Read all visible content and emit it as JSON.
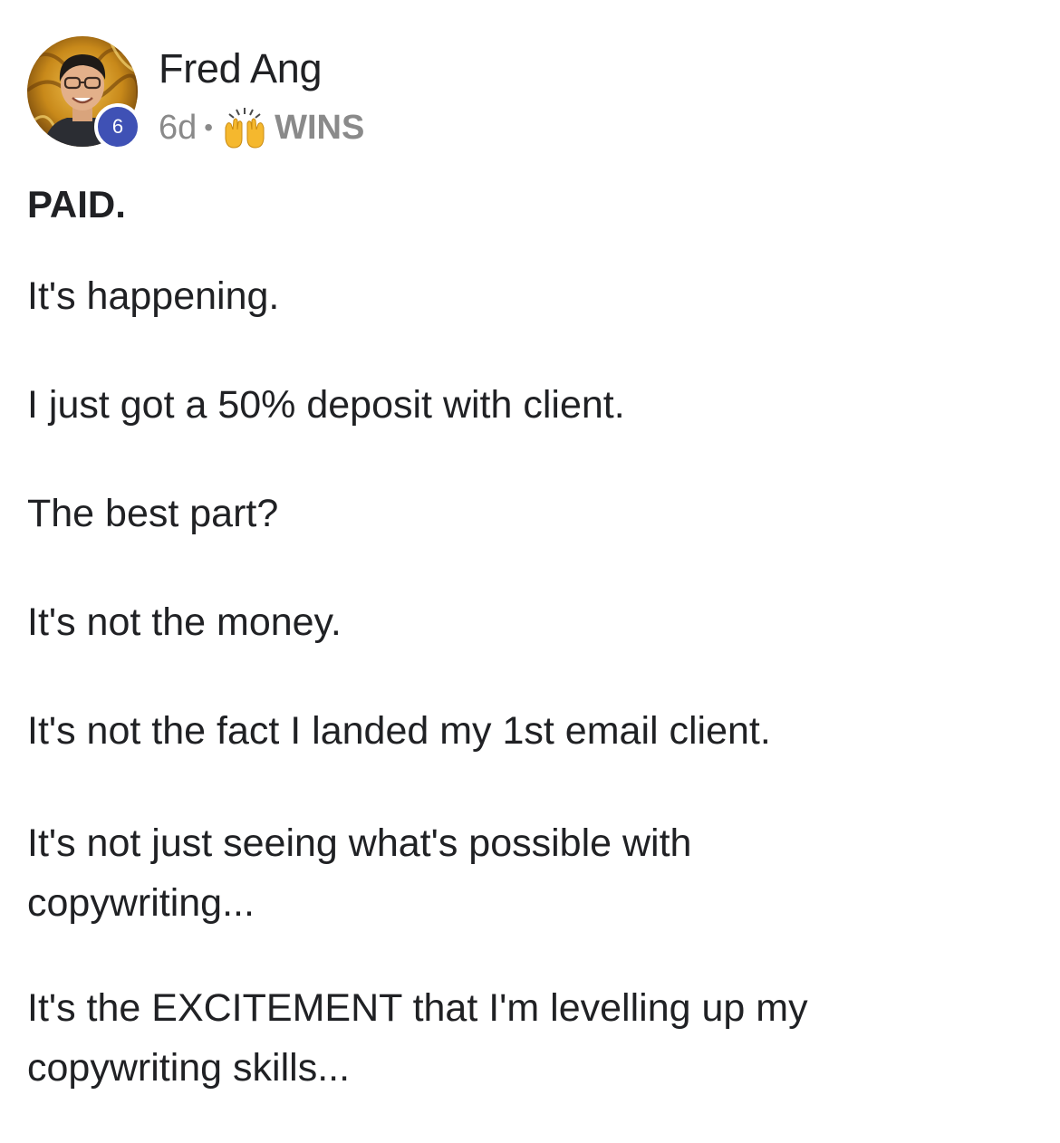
{
  "post": {
    "author": {
      "name": "Fred Ang",
      "level": "6"
    },
    "meta": {
      "age": "6d",
      "separator": "•",
      "category_icon": "raising-hands-emoji",
      "category": "WINS"
    },
    "title": "PAID.",
    "paragraphs": [
      "It's happening.",
      "I just got a 50% deposit with client.",
      "The best part?",
      "It's not the money.",
      "It's not the fact I landed my 1st email client.",
      "It's not just seeing what's possible with copywriting...",
      "It's the EXCITEMENT that I'm levelling up my copywriting skills..."
    ]
  },
  "colors": {
    "text": "#202124",
    "meta": "#8a8a8a",
    "badge": "#3f51b5",
    "avatar_bg": "#b8860b"
  }
}
